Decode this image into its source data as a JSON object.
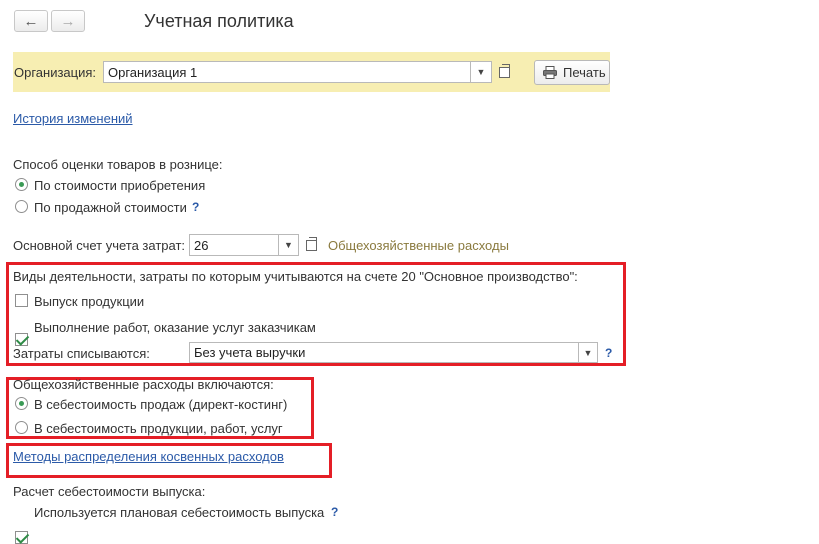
{
  "window": {
    "title": "Учетная политика"
  },
  "nav": {
    "back_icon": "←",
    "forward_icon": "→"
  },
  "toolbar": {
    "org_label": "Организация:",
    "org_value": "Организация 1",
    "print_label": "Печать"
  },
  "history_link": "История изменений",
  "retail_valuation": {
    "label": "Способ оценки товаров в рознице:",
    "options": [
      {
        "label": "По стоимости приобретения",
        "selected": true
      },
      {
        "label": "По продажной стоимости",
        "selected": false
      }
    ],
    "help": "?"
  },
  "cost_account": {
    "label": "Основной счет учета затрат:",
    "value": "26",
    "hint": "Общехозяйственные расходы"
  },
  "activities": {
    "label": "Виды деятельности, затраты по которым учитываются на счете 20 \"Основное производство\":",
    "items": [
      {
        "label": "Выпуск продукции",
        "checked": false
      },
      {
        "label": "Выполнение работ, оказание услуг заказчикам",
        "checked": true
      }
    ],
    "writeoff_label": "Затраты списываются:",
    "writeoff_value": "Без учета выручки",
    "help": "?"
  },
  "overhead": {
    "label": "Общехозяйственные расходы включаются:",
    "options": [
      {
        "label": "В себестоимость продаж (директ-костинг)",
        "selected": true
      },
      {
        "label": "В  себестоимость продукции, работ, услуг",
        "selected": false
      }
    ]
  },
  "indirect_link": "Методы распределения косвенных расходов",
  "calc": {
    "label": "Расчет себестоимости выпуска:",
    "planned_label": "Используется плановая себестоимость выпуска",
    "planned_checked": true,
    "help": "?"
  },
  "colors": {
    "highlight_border": "#e41e26",
    "toolbar_bg": "#f7eeb2",
    "link": "#2b5aa8"
  }
}
